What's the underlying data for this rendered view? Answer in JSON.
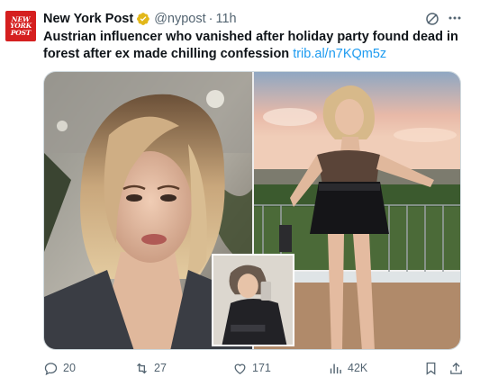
{
  "tweet": {
    "avatar_text": [
      "NEW",
      "YORK",
      "POST"
    ],
    "author_name": "New York Post",
    "handle": "@nypost",
    "separator": "·",
    "time": "11h",
    "text": "Austrian influencer who vanished after holiday party found dead in forest after ex made chilling confession",
    "link": "trib.al/n7KQm5z"
  },
  "actions": {
    "replies": "20",
    "reposts": "27",
    "likes": "171",
    "views": "42K"
  },
  "colors": {
    "brand": "#d51f1f",
    "link": "#1d9bf0",
    "muted": "#536471",
    "verified_gold": "#e2b719"
  }
}
